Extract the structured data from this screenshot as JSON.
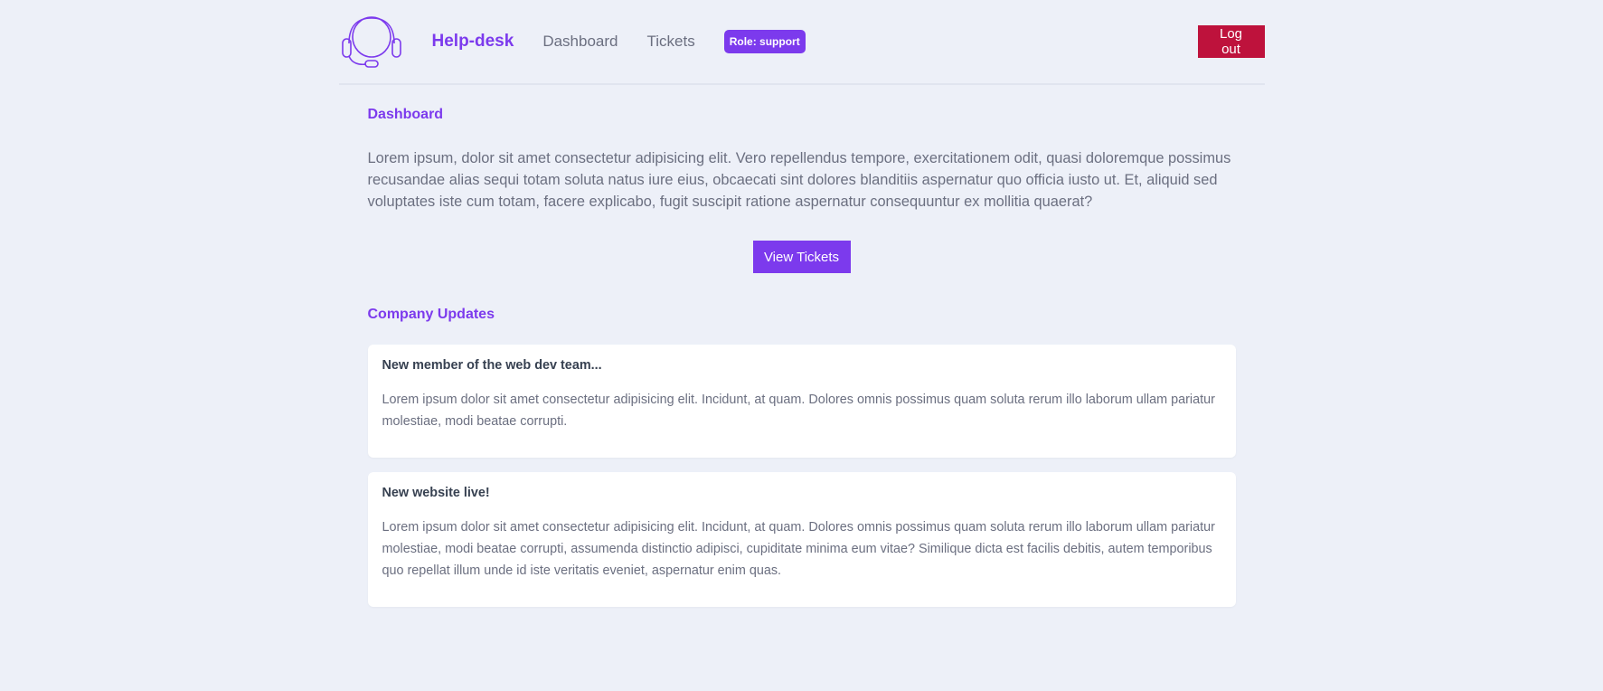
{
  "navbar": {
    "logo_icon": "headset-icon",
    "brand": "Help-desk",
    "links": [
      "Dashboard",
      "Tickets"
    ],
    "role_badge": "Role: support",
    "logout_label": "Log out"
  },
  "page": {
    "title": "Dashboard",
    "intro": "Lorem ipsum, dolor sit amet consectetur adipisicing elit. Vero repellendus tempore, exercitationem odit, quasi doloremque possimus recusandae alias sequi totam soluta natus iure eius, obcaecati sint dolores blanditiis aspernatur quo officia iusto ut. Et, aliquid sed voluptates iste cum totam, facere explicabo, fugit suscipit ratione aspernatur consequuntur ex mollitia quaerat?",
    "view_tickets_label": "View Tickets"
  },
  "updates": {
    "title": "Company Updates",
    "items": [
      {
        "title": "New member of the web dev team...",
        "body": "Lorem ipsum dolor sit amet consectetur adipisicing elit. Incidunt, at quam. Dolores omnis possimus quam soluta rerum illo laborum ullam pariatur molestiae, modi beatae corrupti."
      },
      {
        "title": "New website live!",
        "body": "Lorem ipsum dolor sit amet consectetur adipisicing elit. Incidunt, at quam. Dolores omnis possimus quam soluta rerum illo laborum ullam pariatur molestiae, modi beatae corrupti, assumenda distinctio adipisci, cupiditate minima eum vitae? Similique dicta est facilis debitis, autem temporibus quo repellat illum unde id iste veritatis eveniet, aspernatur enim quas."
      }
    ]
  },
  "colors": {
    "accent": "#7c3aed",
    "danger": "#be123c",
    "background": "#edf0f8"
  }
}
